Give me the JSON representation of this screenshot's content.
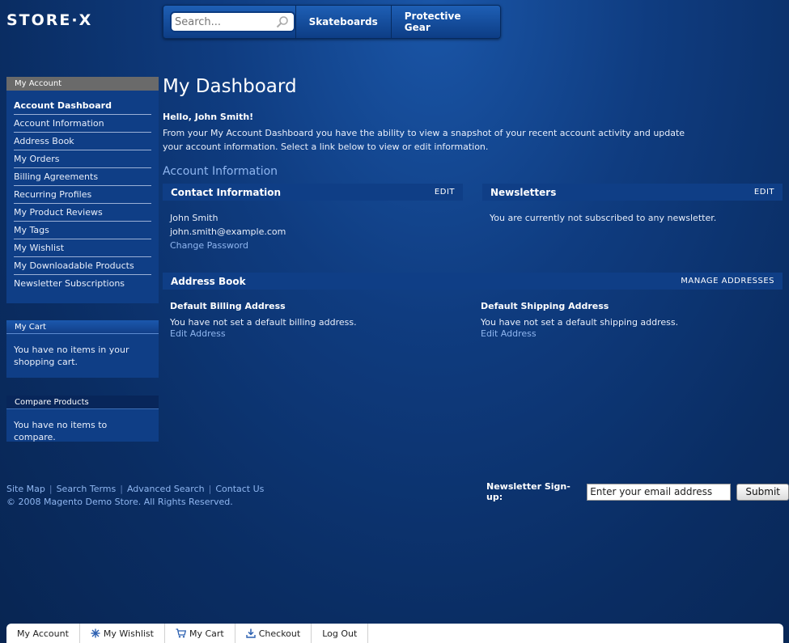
{
  "brand": {
    "logo": "STORE·X"
  },
  "header": {
    "search_placeholder": "Search...",
    "nav": [
      "Skateboards",
      "Protective Gear"
    ]
  },
  "sidebar": {
    "account": {
      "title": "My Account",
      "items": [
        "Account Dashboard",
        "Account Information",
        "Address Book",
        "My Orders",
        "Billing Agreements",
        "Recurring Profiles",
        "My Product Reviews",
        "My Tags",
        "My Wishlist",
        "My Downloadable Products",
        "Newsletter Subscriptions"
      ]
    },
    "cart": {
      "title": "My Cart",
      "message": "You have no items in your shopping cart."
    },
    "compare": {
      "title": "Compare Products",
      "message": "You have no items to compare."
    }
  },
  "main": {
    "title": "My Dashboard",
    "hello": "Hello, John Smith!",
    "intro": "From your My Account Dashboard you have the ability to view a snapshot of your recent account activity and update your account information. Select a link below to view or edit information.",
    "account_info_title": "Account Information",
    "contact": {
      "title": "Contact Information",
      "edit": "EDIT",
      "name": "John Smith",
      "email": "john.smith@example.com",
      "change_password": "Change Password"
    },
    "newsletters": {
      "title": "Newsletters",
      "edit": "EDIT",
      "message": "You are currently not subscribed to any newsletter."
    },
    "address_book": {
      "title": "Address Book",
      "manage": "MANAGE ADDRESSES",
      "billing_title": "Default Billing Address",
      "billing_text": "You have not set a default billing address.",
      "billing_link": "Edit Address",
      "shipping_title": "Default Shipping Address",
      "shipping_text": "You have not set a default shipping address.",
      "shipping_link": "Edit Address"
    }
  },
  "footer": {
    "links": [
      "Site Map",
      "Search Terms",
      "Advanced Search",
      "Contact Us"
    ],
    "copyright": "© 2008 Magento Demo Store. All Rights Reserved.",
    "newsletter_label": "Newsletter Sign-up:",
    "newsletter_value": "Enter your email address",
    "submit": "Submit"
  },
  "bottom_bar": {
    "items": [
      "My Account",
      "My Wishlist",
      "My Cart",
      "Checkout",
      "Log Out"
    ]
  }
}
